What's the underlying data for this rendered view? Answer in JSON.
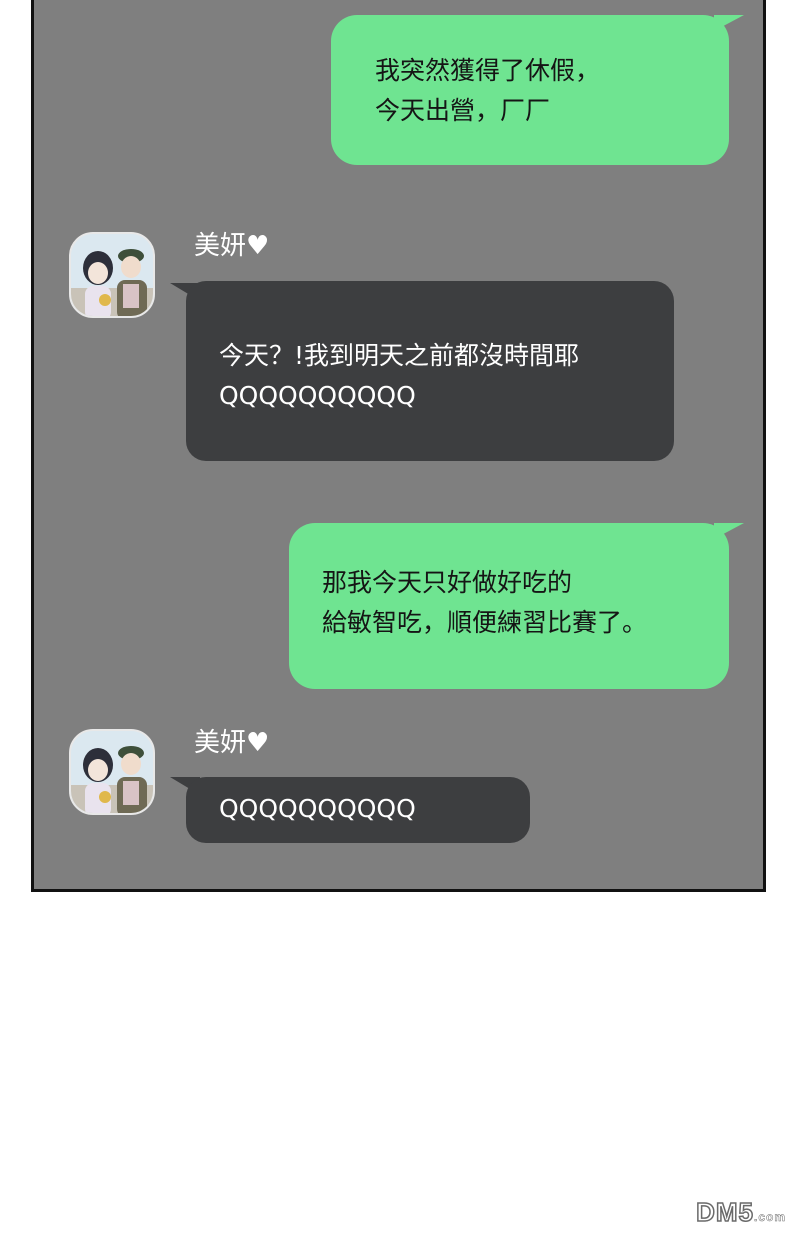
{
  "messages": [
    {
      "side": "right",
      "text": "我突然獲得了休假，\n今天出營，厂厂"
    },
    {
      "side": "left",
      "sender": "美妍♥",
      "text": "今天？!我到明天之前都沒時間耶\nQQQQQQQQQQ"
    },
    {
      "side": "right",
      "text": "那我今天只好做好吃的\n給敏智吃，順便練習比賽了。"
    },
    {
      "side": "left",
      "sender": "美妍♥",
      "text": "QQQQQQQQQQ"
    }
  ],
  "watermark": {
    "main": "DM5",
    "suffix": ".com"
  },
  "colors": {
    "panel": "#7f7f7f",
    "green_bubble": "#6fe491",
    "dark_bubble": "#3d3e40"
  }
}
